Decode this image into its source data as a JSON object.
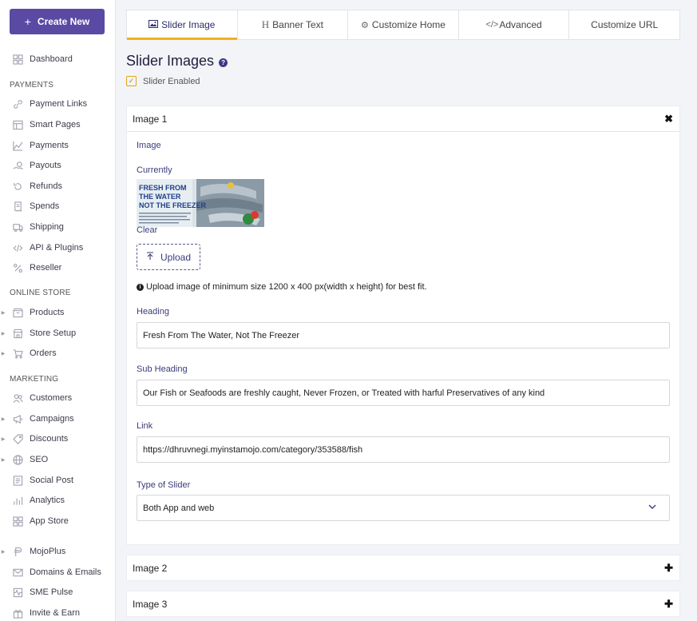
{
  "sidebar": {
    "create_label": "Create New",
    "items": [
      {
        "label": "Dashboard",
        "icon": "dashboard-icon",
        "caret": false
      },
      {
        "label": "Payment Links",
        "icon": "link-icon",
        "caret": false
      },
      {
        "label": "Smart Pages",
        "icon": "page-icon",
        "caret": false
      },
      {
        "label": "Payments",
        "icon": "chart-icon",
        "caret": false
      },
      {
        "label": "Payouts",
        "icon": "payout-icon",
        "caret": false
      },
      {
        "label": "Refunds",
        "icon": "refund-icon",
        "caret": false
      },
      {
        "label": "Spends",
        "icon": "receipt-icon",
        "caret": false
      },
      {
        "label": "Shipping",
        "icon": "shipping-icon",
        "caret": false
      },
      {
        "label": "API & Plugins",
        "icon": "code-icon",
        "caret": false
      },
      {
        "label": "Reseller",
        "icon": "percent-icon",
        "caret": false
      },
      {
        "label": "Products",
        "icon": "products-icon",
        "caret": true
      },
      {
        "label": "Store Setup",
        "icon": "store-icon",
        "caret": true
      },
      {
        "label": "Orders",
        "icon": "orders-icon",
        "caret": true
      },
      {
        "label": "Customers",
        "icon": "customers-icon",
        "caret": false
      },
      {
        "label": "Campaigns",
        "icon": "megaphone-icon",
        "caret": true
      },
      {
        "label": "Discounts",
        "icon": "discount-icon",
        "caret": true
      },
      {
        "label": "SEO",
        "icon": "globe-icon",
        "caret": true
      },
      {
        "label": "Social Post",
        "icon": "post-icon",
        "caret": false
      },
      {
        "label": "Analytics",
        "icon": "analytics-icon",
        "caret": false
      },
      {
        "label": "App Store",
        "icon": "apps-icon",
        "caret": false
      },
      {
        "label": "MojoPlus",
        "icon": "mojoplus-icon",
        "caret": true
      },
      {
        "label": "Domains & Emails",
        "icon": "mail-icon",
        "caret": false
      },
      {
        "label": "SME Pulse",
        "icon": "pulse-icon",
        "caret": false
      },
      {
        "label": "Invite & Earn",
        "icon": "gift-icon",
        "caret": false
      }
    ],
    "sections": {
      "payments": "PAYMENTS",
      "online_store": "ONLINE STORE",
      "marketing": "MARKETING"
    }
  },
  "tabs": [
    {
      "label": "Slider Image",
      "icon": "image-icon",
      "active": true
    },
    {
      "label": "Banner Text",
      "icon": "heading-icon",
      "active": false
    },
    {
      "label": "Customize Home",
      "icon": "gear-icon",
      "active": false
    },
    {
      "label": "Advanced",
      "icon": "code-icon",
      "active": false
    },
    {
      "label": "Customize URL",
      "icon": "",
      "active": false
    }
  ],
  "page": {
    "title": "Slider Images",
    "slider_enabled_label": "Slider Enabled",
    "slider_enabled": true
  },
  "image1": {
    "title": "Image 1",
    "image_label": "Image",
    "currently_label": "Currently",
    "clear_label": "Clear",
    "upload_label": "Upload",
    "info_text": "Upload image of minimum size 1200 x 400 px(width x height) for best fit.",
    "thumb_text": "FRESH FROM THE WATER NOT THE FREEZER",
    "heading_label": "Heading",
    "heading_value": "Fresh From The Water, Not The Freezer",
    "subheading_label": "Sub Heading",
    "subheading_value": "Our Fish or Seafoods are freshly caught, Never Frozen, or Treated with harful Preservatives of any kind",
    "link_label": "Link",
    "link_value": "https://dhruvnegi.myinstamojo.com/category/353588/fish",
    "type_label": "Type of Slider",
    "type_value": "Both App and web"
  },
  "image2": {
    "title": "Image 2"
  },
  "image3": {
    "title": "Image 3"
  },
  "colors": {
    "accent": "#5b4aa3",
    "tab_underline": "#f2b01e",
    "label": "#3b3b7a"
  }
}
